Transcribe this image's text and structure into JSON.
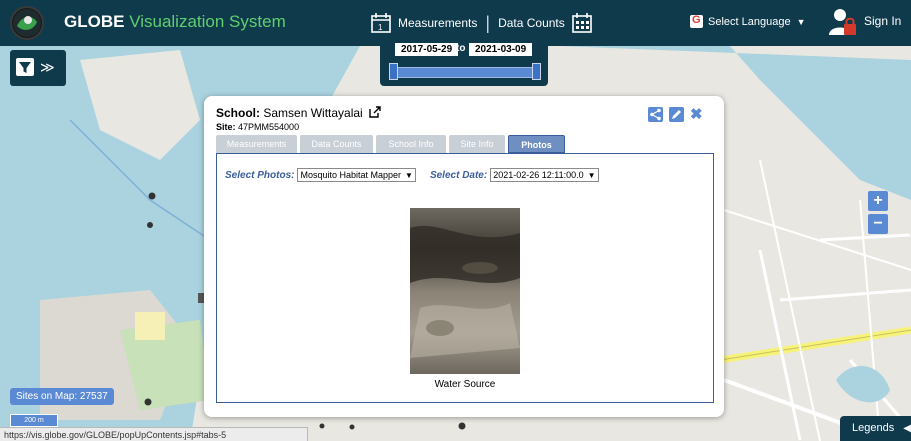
{
  "header": {
    "title_main": "GLOBE",
    "title_accent": "Visualization System",
    "measurements_label": "Measurements",
    "data_counts_label": "Data Counts",
    "language_label": "Select Language",
    "signin_label": "Sign In"
  },
  "date_range": {
    "start": "2017-05-29",
    "to_label": "to",
    "end": "2021-03-09"
  },
  "popup": {
    "school_label": "School:",
    "school_name": "Samsen Wittayalai",
    "site_label": "Site:",
    "site_id": "47PMM554000",
    "tabs": [
      {
        "label": "Measurements",
        "active": false
      },
      {
        "label": "Data Counts",
        "active": false
      },
      {
        "label": "School Info",
        "active": false
      },
      {
        "label": "Site Info",
        "active": false
      },
      {
        "label": "Photos",
        "active": true
      }
    ],
    "select_photos_label": "Select Photos:",
    "select_photos_value": "Mosquito Habitat Mapper",
    "select_date_label": "Select Date:",
    "select_date_value": "2021-02-26 12:11:00.0",
    "photo_caption": "Water Source"
  },
  "map": {
    "sites_count": "Sites on Map: 27537",
    "scale_label": "200 m",
    "zoom_in": "+",
    "zoom_out": "−"
  },
  "legends_label": "Legends",
  "status_url": "https://vis.globe.gov/GLOBE/popUpContents.jsp#tabs-5",
  "icons": {
    "logo": "globe-logo-icon",
    "measurements": "calendar-icon",
    "data_counts": "calendar-grid-icon",
    "language": "google-translate-icon",
    "user": "user-lock-icon",
    "filter": "filter-icon",
    "share": "share-icon",
    "edit": "edit-icon",
    "close": "close-icon",
    "external": "external-link-icon"
  },
  "colors": {
    "header_bg": "#0f3a4c",
    "accent_green": "#5fce6d",
    "ui_blue": "#5b8ad4",
    "tab_active": "#6f8fc2",
    "lock_red": "#d33a2c"
  }
}
